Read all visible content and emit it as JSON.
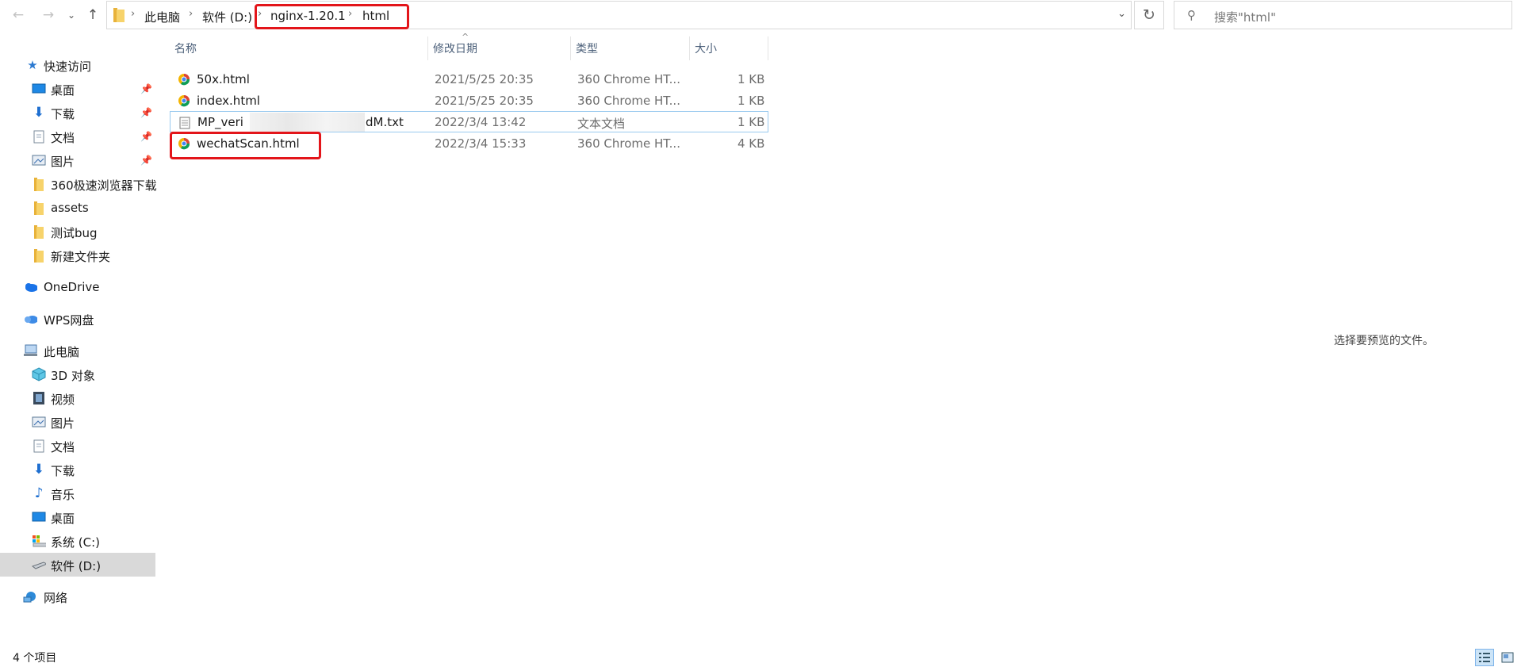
{
  "toolbar": {
    "back_icon": "←",
    "forward_icon": "→",
    "dropdown_icon": "⌄",
    "up_icon": "↑"
  },
  "breadcrumb": {
    "items": [
      "此电脑",
      "软件 (D:)",
      "nginx-1.20.1",
      "html"
    ],
    "separator": "›"
  },
  "address_dropdown_icon": "⌄",
  "refresh_icon": "↻",
  "search": {
    "placeholder": "搜索\"html\"",
    "icon": "⚲"
  },
  "sidebar": {
    "items": [
      {
        "label": "快速访问",
        "icon": "star-icon"
      },
      {
        "label": "桌面",
        "icon": "desktop-icon",
        "pinned": true
      },
      {
        "label": "下载",
        "icon": "download-icon",
        "pinned": true
      },
      {
        "label": "文档",
        "icon": "document-icon",
        "pinned": true
      },
      {
        "label": "图片",
        "icon": "picture-icon",
        "pinned": true
      },
      {
        "label": "360极速浏览器下载",
        "icon": "folder-icon"
      },
      {
        "label": "assets",
        "icon": "folder-icon"
      },
      {
        "label": "测试bug",
        "icon": "folder-icon"
      },
      {
        "label": "新建文件夹",
        "icon": "folder-icon"
      },
      {
        "label": "OneDrive",
        "icon": "cloud-icon"
      },
      {
        "label": "WPS网盘",
        "icon": "cloud-icon"
      },
      {
        "label": "此电脑",
        "icon": "computer-icon"
      },
      {
        "label": "3D 对象",
        "icon": "cube-icon"
      },
      {
        "label": "视频",
        "icon": "video-icon"
      },
      {
        "label": "图片",
        "icon": "picture-icon"
      },
      {
        "label": "文档",
        "icon": "document-icon"
      },
      {
        "label": "下载",
        "icon": "download-icon"
      },
      {
        "label": "音乐",
        "icon": "music-icon"
      },
      {
        "label": "桌面",
        "icon": "desktop-icon"
      },
      {
        "label": "系统 (C:)",
        "icon": "drive-icon"
      },
      {
        "label": "软件 (D:)",
        "icon": "drive-icon",
        "selected": true
      },
      {
        "label": "网络",
        "icon": "network-icon"
      }
    ],
    "pin_icon": "📌"
  },
  "columns": [
    "名称",
    "修改日期",
    "类型",
    "大小"
  ],
  "sort_arrow": "^",
  "files": [
    {
      "name": "50x.html",
      "modified": "2021/5/25 20:35",
      "type": "360 Chrome HT...",
      "size": "1 KB",
      "icon": "browser-html-icon"
    },
    {
      "name": "index.html",
      "modified": "2021/5/25 20:35",
      "type": "360 Chrome HT...",
      "size": "1 KB",
      "icon": "browser-html-icon"
    },
    {
      "name": "MP_veri",
      "name_tail": "dM.txt",
      "modified": "2022/3/4 13:42",
      "type": "文本文档",
      "size": "1 KB",
      "icon": "text-file-icon"
    },
    {
      "name": "wechatScan.html",
      "modified": "2022/3/4 15:33",
      "type": "360 Chrome HT...",
      "size": "4 KB",
      "icon": "browser-html-icon"
    }
  ],
  "preview_message": "选择要预览的文件。",
  "status": {
    "item_count": "4 个项目"
  },
  "colors": {
    "highlight_red": "#e3151a",
    "selected_bg": "#d9d9d9",
    "focus_border": "#99c9ef",
    "header_text": "#4c607a"
  }
}
